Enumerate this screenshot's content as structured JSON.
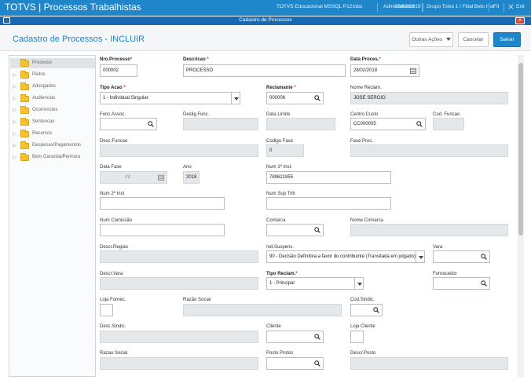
{
  "topbar": {
    "app_title": "TOTVS | Processos Trabalhistas",
    "environment": "TOTVS Educacional MSSQL P12robo",
    "user": "Administrador",
    "date": "28/02/2019",
    "branch": "Grupo Totvs 1 / Filial Belo Hor",
    "filial_code": "FII",
    "exit_label": "Exit"
  },
  "window": {
    "title": "Cadastro de Processos"
  },
  "header": {
    "title": "Cadastro de Processos - INCLUIR",
    "actions_label": "Outras Ações",
    "cancel_label": "Cancelar",
    "save_label": "Salvar"
  },
  "sidebar": {
    "items": [
      {
        "label": "Processo"
      },
      {
        "label": "Peitos"
      },
      {
        "label": "Advogados"
      },
      {
        "label": "Audiencias"
      },
      {
        "label": "Ocorrencies"
      },
      {
        "label": "Sentencas"
      },
      {
        "label": "Recursos"
      },
      {
        "label": "Despesas/Pagamentos"
      },
      {
        "label": "Bem Garantia/Penhora"
      }
    ]
  },
  "form": {
    "nro_processo": {
      "label": "Nro.Processo",
      "value": "000002"
    },
    "descricao": {
      "label": "Descricao",
      "value": "PROCESSO"
    },
    "data_proces": {
      "label": "Data Proces.",
      "value": "28/02/2018"
    },
    "tipo_acao": {
      "label": "Tipo Acao",
      "value": "1 - Individual Singular"
    },
    "reclamante": {
      "label": "Reclamante",
      "value": "000006"
    },
    "nome_reclam": {
      "label": "Nome Reclam.",
      "value": "JOSE SERGIO"
    },
    "func_assoc": {
      "label": "Func.Assoc.",
      "value": ""
    },
    "deslig_func": {
      "label": "Deslig.Func.",
      "value": ""
    },
    "data_limite": {
      "label": "Data Limite",
      "value": ""
    },
    "centro_custo": {
      "label": "Centro Custo",
      "value": "CC000005"
    },
    "cod_funcao": {
      "label": "Cod. Funcao",
      "value": ""
    },
    "desc_funcao": {
      "label": "Desc.Funcao",
      "value": ""
    },
    "codigo_fase": {
      "label": "Codigo Fase",
      "value": "0"
    },
    "fase_proc": {
      "label": "Fase Proc.",
      "value": ""
    },
    "data_fase": {
      "label": "Data Fase",
      "value": "/ /"
    },
    "ano": {
      "label": "Ano",
      "value": "2018"
    },
    "num_1_inst": {
      "label": "Num 1ª Inst.",
      "value": "789621855"
    },
    "num_2_inst": {
      "label": "Num 2ª Inst",
      "value": ""
    },
    "num_sup_trib": {
      "label": "Num Sup Trib",
      "value": ""
    },
    "num_comissao": {
      "label": "Num Comissão",
      "value": ""
    },
    "comarca": {
      "label": "Comarca",
      "value": ""
    },
    "nome_comarca": {
      "label": "Nome Comarca",
      "value": ""
    },
    "descr_regiao": {
      "label": "Descr.Regiao",
      "value": ""
    },
    "ind_suspens": {
      "label": "Ind.Suspens.",
      "value": "90 - Decisão Definitiva a favor do contribuinte (Transitada em julgado)"
    },
    "vara": {
      "label": "Vara",
      "value": ""
    },
    "descr_vara": {
      "label": "Descr.Vara",
      "value": ""
    },
    "tipo_reclam": {
      "label": "Tipo Reclam.",
      "value": "1 - Principal"
    },
    "fornecedor": {
      "label": "Fornecedor",
      "value": ""
    },
    "loja_fornec": {
      "label": "Loja Fornec.",
      "value": ""
    },
    "razao_social_1": {
      "label": "Razão Social",
      "value": ""
    },
    "cod_sindic": {
      "label": "Cod.Sindic.",
      "value": ""
    },
    "desc_sindic": {
      "label": "Desc.Sindic.",
      "value": ""
    },
    "cliente": {
      "label": "Cliente",
      "value": ""
    },
    "loja_cliente": {
      "label": "Loja Cliente",
      "value": ""
    },
    "razao_social_2": {
      "label": "Razao Social",
      "value": ""
    },
    "posto_protoc": {
      "label": "Posto Protoc",
      "value": ""
    },
    "descr_posto": {
      "label": "Descr.Posto",
      "value": ""
    },
    "required_mark": "*"
  },
  "colors": {
    "brand_blue": "#1f86c9",
    "window_bar": "#1769b4",
    "required_red": "#d9302c",
    "folder_yellow": "#f4c430"
  },
  "icons": {
    "search": "search-icon",
    "calendar": "calendar-icon",
    "folder": "folder-icon",
    "dropdown": "chevron-down-icon"
  }
}
